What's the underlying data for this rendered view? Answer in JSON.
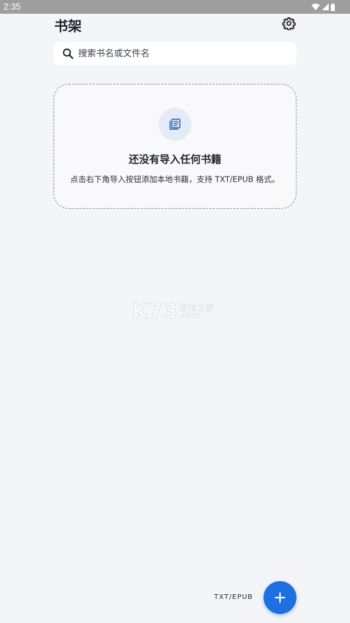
{
  "status_bar": {
    "time": "2:35",
    "icons": [
      "wifi-icon",
      "cellular-signal-icon",
      "battery-icon"
    ]
  },
  "header": {
    "title": "书架",
    "settings_icon": "gear-icon"
  },
  "search": {
    "placeholder": "搜索书名或文件名",
    "value": ""
  },
  "empty_state": {
    "icon": "book-list-icon",
    "title": "还没有导入任何书籍",
    "description": "点击右下角导入按钮添加本地书籍，支持 TXT/EPUB 格式。"
  },
  "watermark": {
    "brand": "K73",
    "site_cn": "游戏之家",
    "site_domain": ".com"
  },
  "fab": {
    "label": "TXT/EPUB",
    "icon": "plus-icon"
  },
  "colors": {
    "background": "#f4f5f8",
    "accent": "#1e6fe0",
    "status_bar": "#9e9e9e"
  }
}
